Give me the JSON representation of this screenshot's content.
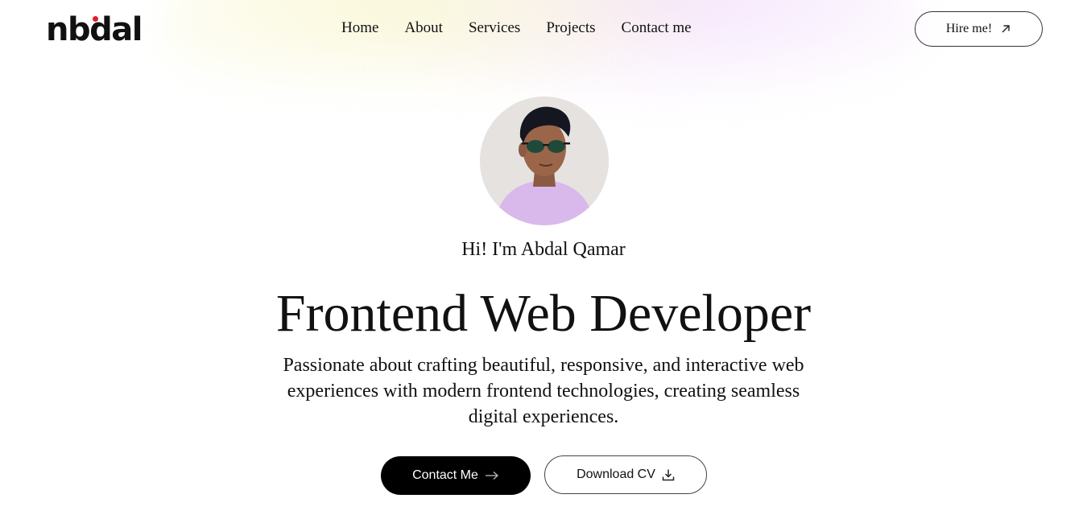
{
  "brand": {
    "logo_text_part1": "n",
    "logo_text_part2": "bdal",
    "accent_dot_color": "#e11d2a"
  },
  "nav": {
    "links": [
      "Home",
      "About",
      "Services",
      "Projects",
      "Contact me"
    ],
    "hire_button_label": "Hire me!",
    "hire_button_icon": "arrow-up-right-icon"
  },
  "hero": {
    "avatar_alt": "portrait photo",
    "greeting": "Hi! I'm Abdal Qamar",
    "headline": "Frontend Web Developer",
    "description": "Passionate about crafting beautiful, responsive, and interactive web experiences with modern frontend technologies, creating seamless digital experiences.",
    "primary_button_label": "Contact Me",
    "primary_button_icon": "arrow-right-icon",
    "secondary_button_label": "Download CV",
    "secondary_button_icon": "download-icon"
  },
  "colors": {
    "primary_button_bg": "#000000",
    "text": "#111111",
    "glow_yellow": "#faf8d7",
    "glow_purple": "#f4e2fc"
  }
}
